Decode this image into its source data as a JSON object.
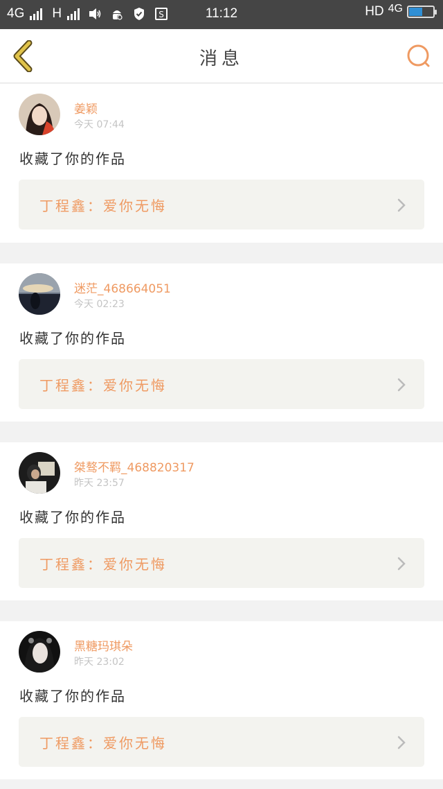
{
  "statusbar": {
    "network1": "4G",
    "network2": "H",
    "time": "11:12",
    "hd": "HD",
    "network3": "4G",
    "battery_level": 0.55
  },
  "header": {
    "title": "消息"
  },
  "colors": {
    "accent": "#ef9a62",
    "back": "#e0c34a"
  },
  "messages": [
    {
      "username": "姜颖",
      "time": "今天 07:44",
      "action": "收藏了你的作品",
      "work": "丁程鑫：爱你无悔"
    },
    {
      "username": "迷茫_468664051",
      "time": "今天 02:23",
      "action": "收藏了你的作品",
      "work": "丁程鑫：爱你无悔"
    },
    {
      "username": "桀骜不羁_468820317",
      "time": "昨天 23:57",
      "action": "收藏了你的作品",
      "work": "丁程鑫：爱你无悔"
    },
    {
      "username": "黑糖玛琪朵",
      "time": "昨天 23:02",
      "action": "收藏了你的作品",
      "work": "丁程鑫：爱你无悔"
    }
  ]
}
